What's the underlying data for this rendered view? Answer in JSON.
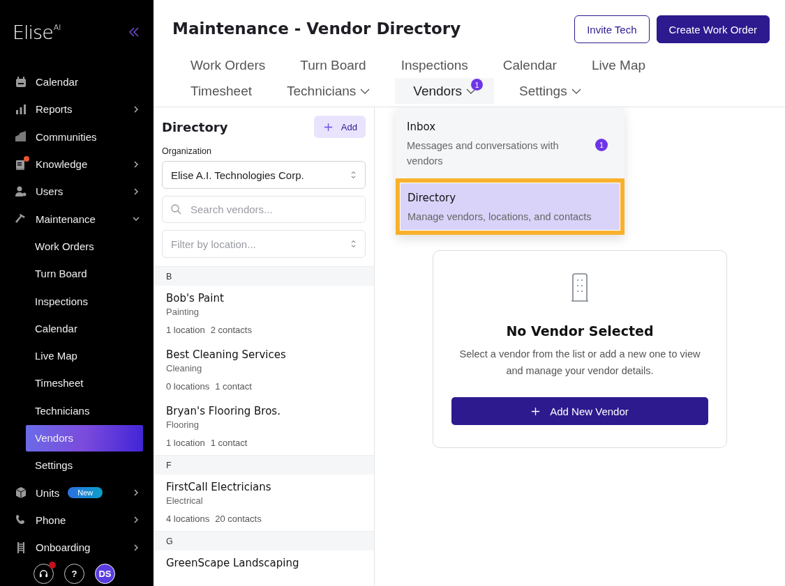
{
  "sidebar": {
    "logo": {
      "name": "Elise",
      "mark": "AI"
    },
    "items": [
      {
        "label": "Calendar",
        "kind": "link",
        "alert": false
      },
      {
        "label": "Reports",
        "kind": "group",
        "expanded": false,
        "alert": false
      },
      {
        "label": "Communities",
        "kind": "link",
        "alert": false
      },
      {
        "label": "Knowledge",
        "kind": "group",
        "expanded": false,
        "alert": true
      },
      {
        "label": "Users",
        "kind": "group",
        "expanded": false,
        "alert": false
      },
      {
        "label": "Maintenance",
        "kind": "group",
        "expanded": true,
        "alert": false,
        "children": [
          {
            "label": "Work Orders",
            "selected": false
          },
          {
            "label": "Turn Board",
            "selected": false
          },
          {
            "label": "Inspections",
            "selected": false
          },
          {
            "label": "Calendar",
            "selected": false
          },
          {
            "label": "Live Map",
            "selected": false
          },
          {
            "label": "Timesheet",
            "selected": false
          },
          {
            "label": "Technicians",
            "selected": false
          },
          {
            "label": "Vendors",
            "selected": true
          },
          {
            "label": "Settings",
            "selected": false
          }
        ]
      },
      {
        "label": "Units",
        "kind": "group",
        "expanded": false,
        "alert": false,
        "badge": "New"
      },
      {
        "label": "Phone",
        "kind": "group",
        "expanded": false,
        "alert": false
      },
      {
        "label": "Onboarding",
        "kind": "group",
        "expanded": false,
        "alert": false
      }
    ],
    "footer": {
      "support_alert": true,
      "help": "?",
      "avatar": "DS"
    }
  },
  "header": {
    "title": "Maintenance - Vendor Directory",
    "buttons": [
      {
        "label": "Invite Tech",
        "kind": "outline"
      },
      {
        "label": "Create Work Order",
        "kind": "primary"
      }
    ],
    "tab_rows": [
      [
        {
          "label": "Work Orders",
          "selected": false,
          "dropdown": false
        },
        {
          "label": "Turn Board",
          "selected": false,
          "dropdown": false
        },
        {
          "label": "Inspections",
          "selected": false,
          "dropdown": false
        },
        {
          "label": "Calendar",
          "selected": false,
          "dropdown": false
        },
        {
          "label": "Live Map",
          "selected": false,
          "dropdown": false
        }
      ],
      [
        {
          "label": "Timesheet",
          "selected": false,
          "dropdown": false
        },
        {
          "label": "Technicians",
          "selected": false,
          "dropdown": true
        },
        {
          "label": "Vendors",
          "selected": true,
          "dropdown": true,
          "badge": "1"
        },
        {
          "label": "Settings",
          "selected": false,
          "dropdown": true
        }
      ]
    ]
  },
  "vendors_menu": {
    "items": [
      {
        "title": "Inbox",
        "description": "Messages and conversations with vendors",
        "badge": "1",
        "selected": false
      },
      {
        "title": "Directory",
        "description": "Manage vendors, locations, and contacts",
        "selected": true
      }
    ]
  },
  "directory": {
    "title": "Directory",
    "add_button": "Add",
    "organization_label": "Organization",
    "organization": "Elise A.I. Technologies Corp.",
    "search_placeholder": "Search vendors...",
    "filter_placeholder": "Filter by location...",
    "groups": [
      {
        "letter": "B",
        "vendors": [
          {
            "name": "Bob's Paint",
            "category": "Painting",
            "locations": "1 location",
            "contacts": "2 contacts"
          },
          {
            "name": "Best Cleaning Services",
            "category": "Cleaning",
            "locations": "0 locations",
            "contacts": "1 contact"
          },
          {
            "name": "Bryan's Flooring Bros.",
            "category": "Flooring",
            "locations": "1 location",
            "contacts": "1 contact"
          }
        ]
      },
      {
        "letter": "F",
        "vendors": [
          {
            "name": "FirstCall Electricians",
            "category": "Electrical",
            "locations": "4 locations",
            "contacts": "20 contacts"
          }
        ]
      },
      {
        "letter": "G",
        "vendors": [
          {
            "name": "GreenScape Landscaping"
          }
        ]
      }
    ]
  },
  "empty_state": {
    "title": "No Vendor Selected",
    "message": "Select a vendor from the list or add a new one to view and manage your vendor details.",
    "button": "Add New Vendor"
  }
}
